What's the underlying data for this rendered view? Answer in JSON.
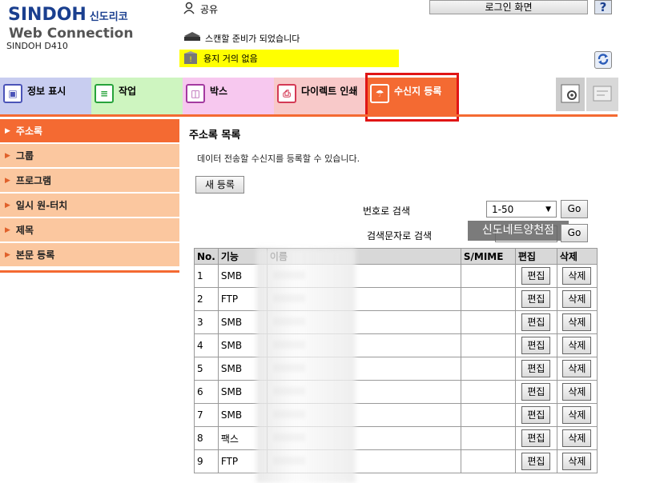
{
  "header": {
    "brand": "SINDOH",
    "brand_kr": "신도리코",
    "product": "Web Connection",
    "model": "SINDOH D410",
    "user": "공유",
    "login_button": "로그인 화면",
    "help_button": "?",
    "scan_status": "스캔할 준비가 되었습니다",
    "warning": "용지 거의 없음"
  },
  "tabs": [
    {
      "label": "정보 표시"
    },
    {
      "label": "작업"
    },
    {
      "label": "박스"
    },
    {
      "label": "다이렉트 인쇄"
    },
    {
      "label": "수신지 등록"
    }
  ],
  "sidebar": {
    "items": [
      {
        "label": "주소록",
        "active": true
      },
      {
        "label": "그룹"
      },
      {
        "label": "프로그램"
      },
      {
        "label": "일시 원-터치"
      },
      {
        "label": "제목"
      },
      {
        "label": "본문 등록"
      }
    ]
  },
  "main": {
    "title": "주소록 목록",
    "description": "데이터 전송할 수신지를 등록할 수 있습니다.",
    "new_button": "새 등록",
    "search_number_label": "번호로 검색",
    "search_number_value": "1-50",
    "go_label": "Go",
    "search_text_label": "검색문자로 검색",
    "watermark": "신도네트양천점"
  },
  "table": {
    "headers": [
      "No.",
      "기능",
      "이름",
      "S/MIME",
      "편집",
      "삭제"
    ],
    "edit_label": "편집",
    "delete_label": "삭제",
    "rows": [
      {
        "no": "1",
        "fn": "SMB"
      },
      {
        "no": "2",
        "fn": "FTP"
      },
      {
        "no": "3",
        "fn": "SMB"
      },
      {
        "no": "4",
        "fn": "SMB"
      },
      {
        "no": "5",
        "fn": "SMB"
      },
      {
        "no": "6",
        "fn": "SMB"
      },
      {
        "no": "7",
        "fn": "SMB"
      },
      {
        "no": "8",
        "fn": "팩스"
      },
      {
        "no": "9",
        "fn": "FTP"
      }
    ]
  },
  "colors": {
    "accent": "#f46a32",
    "highlight_frame": "#e01515",
    "warning_bg": "#ffff00",
    "brand": "#1a3f8f"
  }
}
